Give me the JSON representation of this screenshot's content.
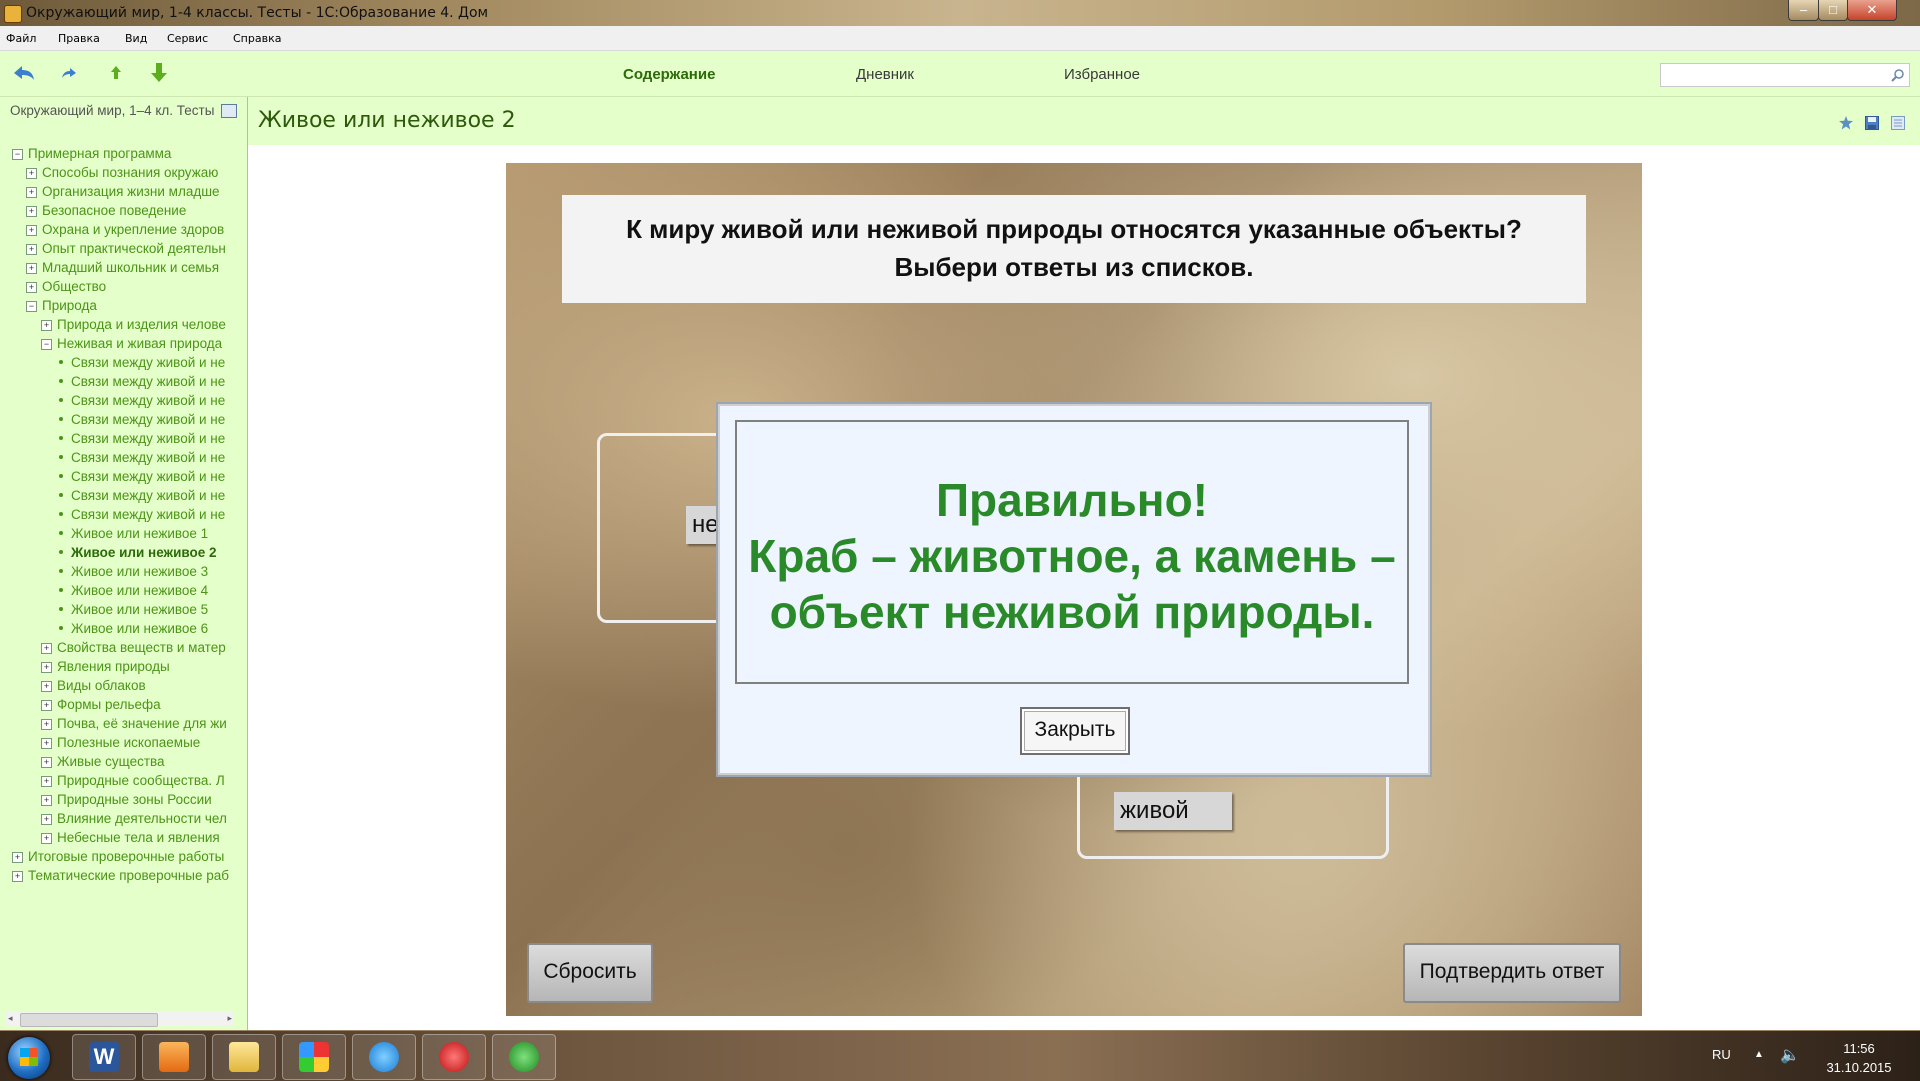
{
  "window": {
    "title": "Окружающий мир, 1-4 классы. Тесты - 1С:Образование 4. Дом",
    "controls": {
      "minimize": "–",
      "maximize": "□",
      "close": "✕"
    }
  },
  "menu": [
    "Файл",
    "Правка",
    "Вид",
    "Сервис",
    "Справка"
  ],
  "toolbar": {
    "icons": [
      "back-arrow-icon",
      "forward-arrow-icon",
      "up-arrow-icon",
      "down-arrow-icon"
    ],
    "tabs": [
      {
        "label": "Содержание",
        "active": true
      },
      {
        "label": "Дневник",
        "active": false
      },
      {
        "label": "Избранное",
        "active": false
      }
    ],
    "search": {
      "value": "",
      "placeholder": ""
    }
  },
  "sidebar": {
    "header": "Окружающий мир, 1–4 кл. Тесты",
    "tree": [
      {
        "label": "Примерная программа",
        "level": 0,
        "type": "expanded"
      },
      {
        "label": "Способы познания окружаю",
        "level": 1,
        "type": "collapsed"
      },
      {
        "label": "Организация жизни младше",
        "level": 1,
        "type": "collapsed"
      },
      {
        "label": "Безопасное поведение",
        "level": 1,
        "type": "collapsed"
      },
      {
        "label": "Охрана и укрепление здоров",
        "level": 1,
        "type": "collapsed"
      },
      {
        "label": "Опыт практической деятельн",
        "level": 1,
        "type": "collapsed"
      },
      {
        "label": "Младший школьник и семья",
        "level": 1,
        "type": "collapsed"
      },
      {
        "label": "Общество",
        "level": 1,
        "type": "collapsed"
      },
      {
        "label": "Природа",
        "level": 1,
        "type": "expanded"
      },
      {
        "label": "Природа и изделия челове",
        "level": 2,
        "type": "collapsed"
      },
      {
        "label": "Неживая и живая природа",
        "level": 2,
        "type": "expanded"
      },
      {
        "label": "Связи между живой и не",
        "level": 3,
        "type": "leaf"
      },
      {
        "label": "Связи между живой и не",
        "level": 3,
        "type": "leaf"
      },
      {
        "label": "Связи между живой и не",
        "level": 3,
        "type": "leaf"
      },
      {
        "label": "Связи между живой и не",
        "level": 3,
        "type": "leaf"
      },
      {
        "label": "Связи между живой и не",
        "level": 3,
        "type": "leaf"
      },
      {
        "label": "Связи между живой и не",
        "level": 3,
        "type": "leaf"
      },
      {
        "label": "Связи между живой и не",
        "level": 3,
        "type": "leaf"
      },
      {
        "label": "Связи между живой и не",
        "level": 3,
        "type": "leaf"
      },
      {
        "label": "Связи между живой и не",
        "level": 3,
        "type": "leaf"
      },
      {
        "label": "Живое или неживое 1",
        "level": 3,
        "type": "leaf"
      },
      {
        "label": "Живое или неживое 2",
        "level": 3,
        "type": "leaf",
        "current": true
      },
      {
        "label": "Живое или неживое 3",
        "level": 3,
        "type": "leaf"
      },
      {
        "label": "Живое или неживое 4",
        "level": 3,
        "type": "leaf"
      },
      {
        "label": "Живое или неживое 5",
        "level": 3,
        "type": "leaf"
      },
      {
        "label": "Живое или неживое 6",
        "level": 3,
        "type": "leaf"
      },
      {
        "label": "Свойства веществ и матер",
        "level": 2,
        "type": "collapsed"
      },
      {
        "label": "Явления природы",
        "level": 2,
        "type": "collapsed"
      },
      {
        "label": "Виды облаков",
        "level": 2,
        "type": "collapsed"
      },
      {
        "label": "Формы рельефа",
        "level": 2,
        "type": "collapsed"
      },
      {
        "label": "Почва, её значение для жи",
        "level": 2,
        "type": "collapsed"
      },
      {
        "label": "Полезные ископаемые",
        "level": 2,
        "type": "collapsed"
      },
      {
        "label": "Живые существа",
        "level": 2,
        "type": "collapsed"
      },
      {
        "label": "Природные сообщества. Л",
        "level": 2,
        "type": "collapsed"
      },
      {
        "label": "Природные зоны России",
        "level": 2,
        "type": "collapsed"
      },
      {
        "label": "Влияние деятельности чел",
        "level": 2,
        "type": "collapsed"
      },
      {
        "label": "Небесные тела и явления",
        "level": 2,
        "type": "collapsed"
      },
      {
        "label": "Итоговые проверочные работы",
        "level": 0,
        "type": "collapsed"
      },
      {
        "label": "Тематические проверочные раб",
        "level": 0,
        "type": "collapsed"
      }
    ]
  },
  "page": {
    "title": "Живое или неживое 2",
    "header_icons": [
      "star-icon",
      "save-icon",
      "print-icon"
    ]
  },
  "exercise": {
    "question_line1": "К миру живой или неживой природы относятся указанные объекты?",
    "question_line2": "Выбери ответы из списков.",
    "chip_left": "не",
    "chip_right": "живой",
    "reset_label": "Сбросить",
    "confirm_label": "Подтвердить ответ"
  },
  "dialog": {
    "line1": "Правильно!",
    "line2": "Краб – животное, а камень –",
    "line3": "объект неживой природы.",
    "close_label": "Закрыть"
  },
  "taskbar": {
    "apps": [
      "word-icon",
      "media-player-icon",
      "file-explorer-icon",
      "paint-icon",
      "internet-explorer-icon",
      "balloon-app-icon",
      "network-app-icon"
    ],
    "language": "RU",
    "time": "11:56",
    "date": "31.10.2015"
  },
  "colors": {
    "panel_green": "#e4ffc9",
    "tree_text": "#4c9417",
    "title_green": "#2d5a0a",
    "dialog_text": "#2a8a2a"
  }
}
